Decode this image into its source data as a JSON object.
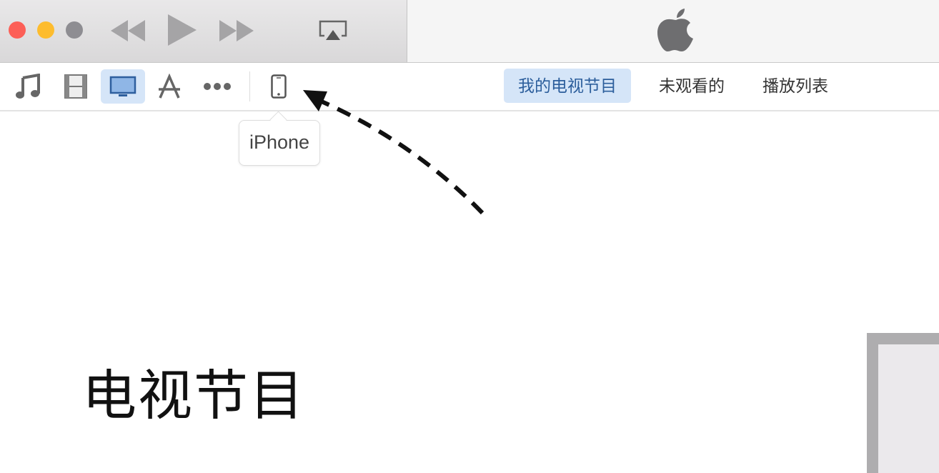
{
  "window": {
    "controls": {
      "close_color": "#fc5f57",
      "minimize_color": "#fdbc2e",
      "zoom_color": "#8e8d92"
    },
    "playback": [
      "rewind-icon",
      "play-icon",
      "fast-forward-icon",
      "airplay-icon"
    ],
    "logo": "apple-logo"
  },
  "toolbar": {
    "media": [
      {
        "name": "music",
        "icon": "music-note-icon"
      },
      {
        "name": "movies",
        "icon": "film-icon"
      },
      {
        "name": "tv-shows",
        "icon": "tv-icon",
        "selected": true
      },
      {
        "name": "apps",
        "icon": "app-store-icon"
      },
      {
        "name": "more",
        "icon": "more-icon"
      }
    ],
    "device_icon": "iphone-icon",
    "tabs": [
      {
        "label": "我的电视节目",
        "selected": true
      },
      {
        "label": "未观看的"
      },
      {
        "label": "播放列表"
      }
    ],
    "accent_color": "#d5e5f8"
  },
  "tooltip": {
    "text": "iPhone"
  },
  "main": {
    "heading": "电视节目"
  }
}
